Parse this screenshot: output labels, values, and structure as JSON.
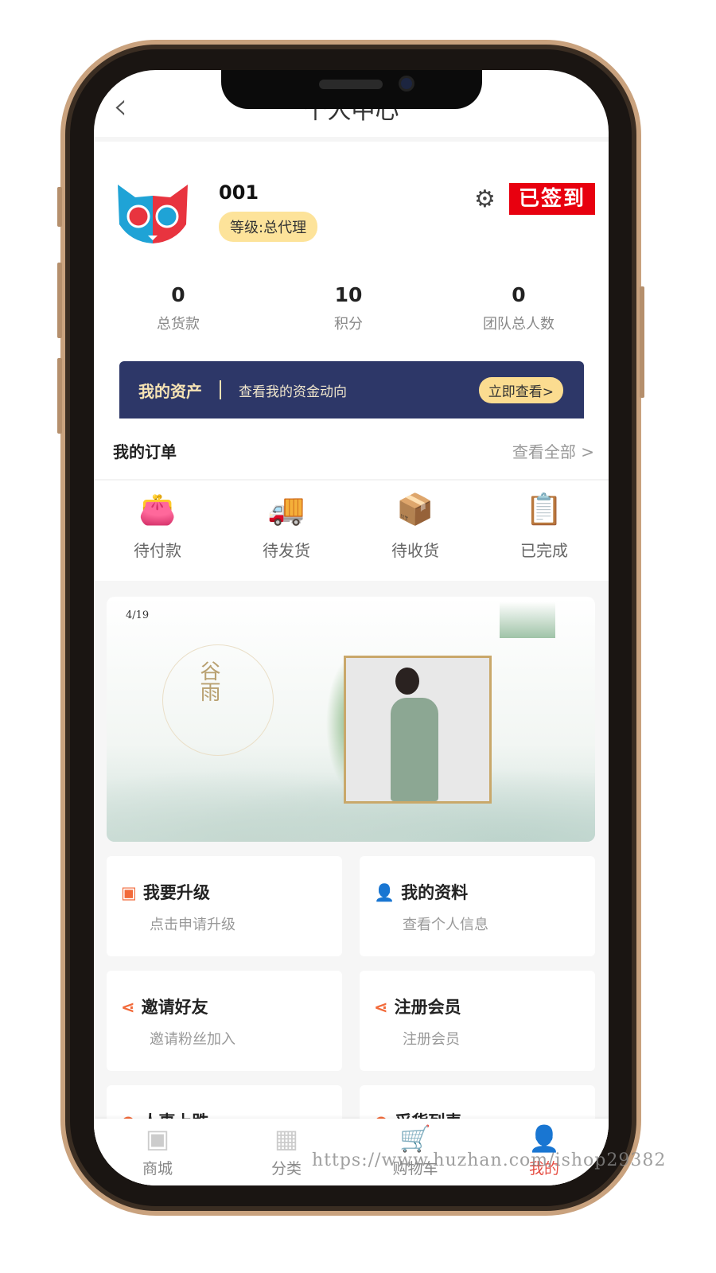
{
  "header": {
    "title": "个人中心",
    "back_icon": "chevron-left-icon"
  },
  "profile": {
    "name": "001",
    "level": "等级:总代理",
    "signed_label": "已签到"
  },
  "stats": [
    {
      "value": "0",
      "label": "总货款"
    },
    {
      "value": "10",
      "label": "积分"
    },
    {
      "value": "0",
      "label": "团队总人数"
    }
  ],
  "asset": {
    "title": "我的资产",
    "desc": "查看我的资金动向",
    "button": "立即查看>"
  },
  "orders": {
    "title": "我的订单",
    "view_all": "查看全部 >",
    "items": [
      {
        "label": "待付款",
        "icon": "wallet-icon"
      },
      {
        "label": "待发货",
        "icon": "truck-icon"
      },
      {
        "label": "待收货",
        "icon": "box-icon"
      },
      {
        "label": "已完成",
        "icon": "clipboard-icon"
      }
    ]
  },
  "banner": {
    "date": "4/19",
    "title": "谷雨"
  },
  "menu": [
    {
      "title": "我要升级",
      "sub": "点击申请升级"
    },
    {
      "title": "我的资料",
      "sub": "查看个人信息"
    },
    {
      "title": "邀请好友",
      "sub": "邀请粉丝加入"
    },
    {
      "title": "注册会员",
      "sub": "注册会员"
    },
    {
      "title": "人事上跌",
      "sub": ""
    },
    {
      "title": "采货列表",
      "sub": ""
    }
  ],
  "tabs": [
    {
      "label": "商城"
    },
    {
      "label": "分类"
    },
    {
      "label": "购物车"
    },
    {
      "label": "我的"
    }
  ],
  "watermark": "https://www.huzhan.com/ishop29382",
  "colors": {
    "accent": "#e54d42",
    "asset_bg": "#2d3768",
    "signed_bg": "#e8000f",
    "level_bg": "#fde39a"
  }
}
